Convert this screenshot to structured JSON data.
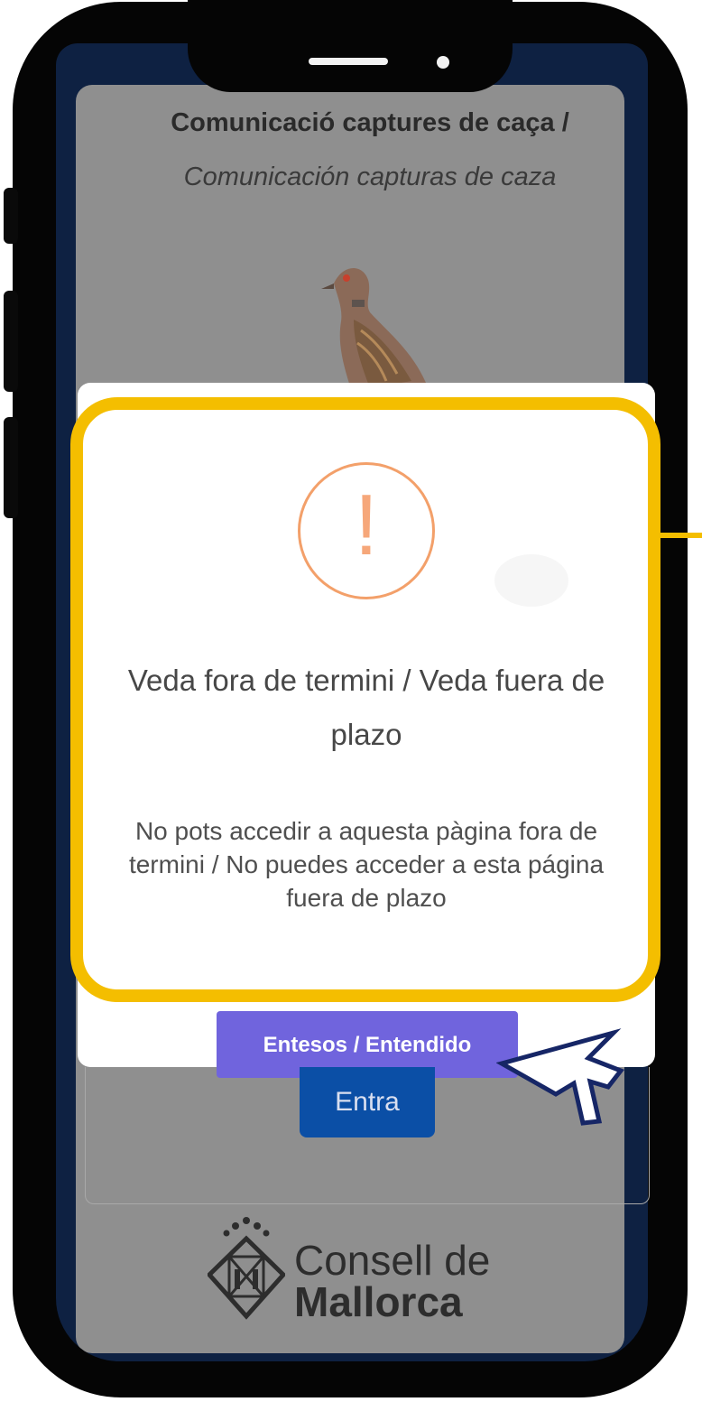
{
  "header": {
    "title_ca": "Comunicació captures de caça /",
    "title_es": "Comunicación capturas de caza"
  },
  "dialog": {
    "icon": "warning-icon",
    "icon_glyph": "!",
    "title": "Veda fora de termini / Veda fuera de plazo",
    "message": "No pots accedir a aquesta pàgina fora de termini / No puedes acceder a esta página fuera de plazo",
    "confirm_label": "Entesos / Entendido"
  },
  "form": {
    "enter_label": "Entra"
  },
  "footer": {
    "logo_line1": "Consell de",
    "logo_line2": "Mallorca"
  },
  "colors": {
    "highlight": "#f4be00",
    "confirm_button": "#7064dd",
    "enter_button": "#0b4fa6",
    "warning": "#f3a06a"
  }
}
